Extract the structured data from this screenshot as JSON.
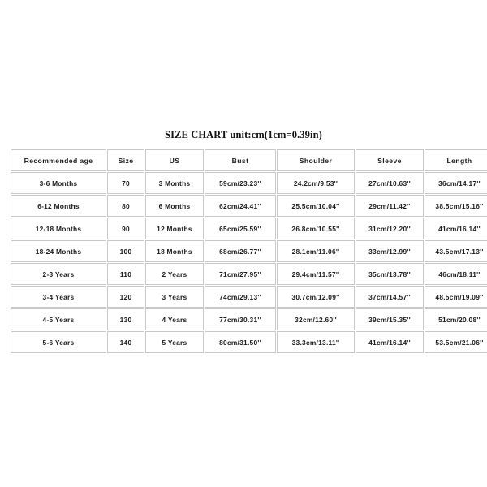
{
  "title": "SIZE CHART unit:cm(1cm=0.39in)",
  "table": {
    "headers": [
      "Recommended age",
      "Size",
      "US",
      "Bust",
      "Shoulder",
      "Sleeve",
      "Length"
    ],
    "rows": [
      [
        "3-6 Months",
        "70",
        "3 Months",
        "59cm/23.23''",
        "24.2cm/9.53''",
        "27cm/10.63''",
        "36cm/14.17''"
      ],
      [
        "6-12 Months",
        "80",
        "6 Months",
        "62cm/24.41''",
        "25.5cm/10.04''",
        "29cm/11.42''",
        "38.5cm/15.16''"
      ],
      [
        "12-18 Months",
        "90",
        "12 Months",
        "65cm/25.59''",
        "26.8cm/10.55''",
        "31cm/12.20''",
        "41cm/16.14''"
      ],
      [
        "18-24 Months",
        "100",
        "18 Months",
        "68cm/26.77''",
        "28.1cm/11.06''",
        "33cm/12.99''",
        "43.5cm/17.13''"
      ],
      [
        "2-3 Years",
        "110",
        "2 Years",
        "71cm/27.95''",
        "29.4cm/11.57''",
        "35cm/13.78''",
        "46cm/18.11''"
      ],
      [
        "3-4 Years",
        "120",
        "3 Years",
        "74cm/29.13''",
        "30.7cm/12.09''",
        "37cm/14.57''",
        "48.5cm/19.09''"
      ],
      [
        "4-5 Years",
        "130",
        "4 Years",
        "77cm/30.31''",
        "32cm/12.60''",
        "39cm/15.35''",
        "51cm/20.08''"
      ],
      [
        "5-6 Years",
        "140",
        "5 Years",
        "80cm/31.50''",
        "33.3cm/13.11''",
        "41cm/16.14''",
        "53.5cm/21.06''"
      ]
    ]
  },
  "colors": {
    "background": "#ffffff",
    "border": "#c9c9c9",
    "text": "#1a1a1a"
  }
}
